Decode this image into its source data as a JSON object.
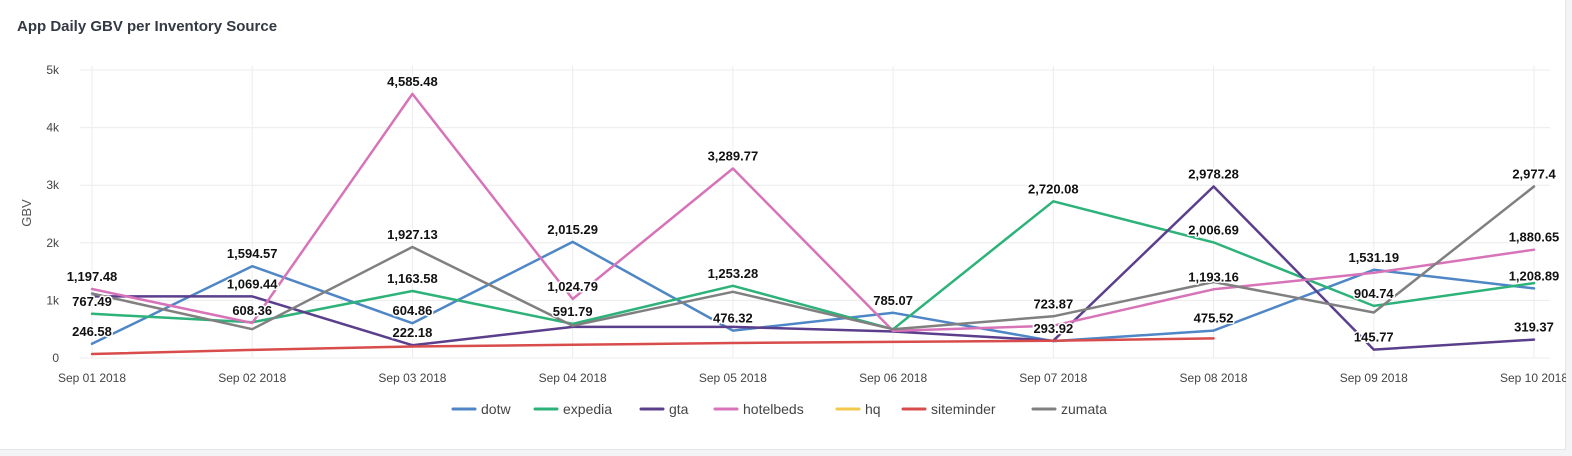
{
  "chart_data": {
    "type": "line",
    "title": "App Daily GBV per Inventory Source",
    "xlabel": "",
    "ylabel": "GBV",
    "ylim": [
      0,
      5000
    ],
    "yticks": [
      {
        "value": 0,
        "label": "0"
      },
      {
        "value": 1000,
        "label": "1k"
      },
      {
        "value": 2000,
        "label": "2k"
      },
      {
        "value": 3000,
        "label": "3k"
      },
      {
        "value": 4000,
        "label": "4k"
      },
      {
        "value": 5000,
        "label": "5k"
      }
    ],
    "grid": true,
    "legend_position": "bottom",
    "categories": [
      "Sep 01 2018",
      "Sep 02 2018",
      "Sep 03 2018",
      "Sep 04 2018",
      "Sep 05 2018",
      "Sep 06 2018",
      "Sep 07 2018",
      "Sep 08 2018",
      "Sep 09 2018",
      "Sep 10 2018"
    ],
    "series": [
      {
        "name": "dotw",
        "color": "#4f86c6",
        "values": [
          246.58,
          1594.57,
          604.86,
          2015.29,
          476.32,
          785.07,
          293.92,
          475.52,
          1531.19,
          1208.89
        ]
      },
      {
        "name": "expedia",
        "color": "#2db27a",
        "values": [
          767.49,
          620,
          1163.58,
          591.79,
          1253.28,
          500,
          2720.08,
          2006.69,
          904.74,
          1300
        ]
      },
      {
        "name": "gta",
        "color": "#5b3f8c",
        "values": [
          1069.44,
          1069.44,
          222.18,
          540,
          540,
          460,
          300,
          2978.28,
          145.77,
          319.37
        ]
      },
      {
        "name": "hotelbeds",
        "color": "#d773b8",
        "values": [
          1197.48,
          608.36,
          4585.48,
          1024.79,
          3289.77,
          470,
          560,
          1193.16,
          1480,
          1880.65
        ]
      },
      {
        "name": "hq",
        "color": "#f2c94c",
        "values": []
      },
      {
        "name": "siteminder",
        "color": "#d84c4c",
        "values": [
          70,
          140,
          200,
          230,
          260,
          280,
          300,
          340,
          null,
          null
        ]
      },
      {
        "name": "zumata",
        "color": "#808080",
        "values": [
          1120,
          500,
          1927.13,
          560,
          1150,
          500,
          723.87,
          1320,
          790,
          2977.4
        ]
      }
    ],
    "data_labels": [
      {
        "series": "hotelbeds",
        "index": 0,
        "text": "1,197.48"
      },
      {
        "series": "expedia",
        "index": 0,
        "text": "767.49"
      },
      {
        "series": "dotw",
        "index": 0,
        "text": "246.58"
      },
      {
        "series": "dotw",
        "index": 1,
        "text": "1,594.57"
      },
      {
        "series": "gta",
        "index": 1,
        "text": "1,069.44"
      },
      {
        "series": "hotelbeds",
        "index": 1,
        "text": "608.36"
      },
      {
        "series": "hotelbeds",
        "index": 2,
        "text": "4,585.48"
      },
      {
        "series": "zumata",
        "index": 2,
        "text": "1,927.13"
      },
      {
        "series": "expedia",
        "index": 2,
        "text": "1,163.58"
      },
      {
        "series": "dotw",
        "index": 2,
        "text": "604.86"
      },
      {
        "series": "gta",
        "index": 2,
        "text": "222.18"
      },
      {
        "series": "dotw",
        "index": 3,
        "text": "2,015.29"
      },
      {
        "series": "hotelbeds",
        "index": 3,
        "text": "1,024.79"
      },
      {
        "series": "expedia",
        "index": 3,
        "text": "591.79"
      },
      {
        "series": "hotelbeds",
        "index": 4,
        "text": "3,289.77"
      },
      {
        "series": "expedia",
        "index": 4,
        "text": "1,253.28"
      },
      {
        "series": "dotw",
        "index": 4,
        "text": "476.32"
      },
      {
        "series": "dotw",
        "index": 5,
        "text": "785.07"
      },
      {
        "series": "expedia",
        "index": 6,
        "text": "2,720.08"
      },
      {
        "series": "zumata",
        "index": 6,
        "text": "723.87"
      },
      {
        "series": "dotw",
        "index": 6,
        "text": "293.92"
      },
      {
        "series": "gta",
        "index": 7,
        "text": "2,978.28"
      },
      {
        "series": "expedia",
        "index": 7,
        "text": "2,006.69"
      },
      {
        "series": "hotelbeds",
        "index": 7,
        "text": "1,193.16"
      },
      {
        "series": "dotw",
        "index": 7,
        "text": "475.52"
      },
      {
        "series": "dotw",
        "index": 8,
        "text": "1,531.19"
      },
      {
        "series": "expedia",
        "index": 8,
        "text": "904.74"
      },
      {
        "series": "gta",
        "index": 8,
        "text": "145.77"
      },
      {
        "series": "zumata",
        "index": 9,
        "text": "2,977.4"
      },
      {
        "series": "hotelbeds",
        "index": 9,
        "text": "1,880.65"
      },
      {
        "series": "dotw",
        "index": 9,
        "text": "1,208.89"
      },
      {
        "series": "gta",
        "index": 9,
        "text": "319.37"
      }
    ]
  }
}
